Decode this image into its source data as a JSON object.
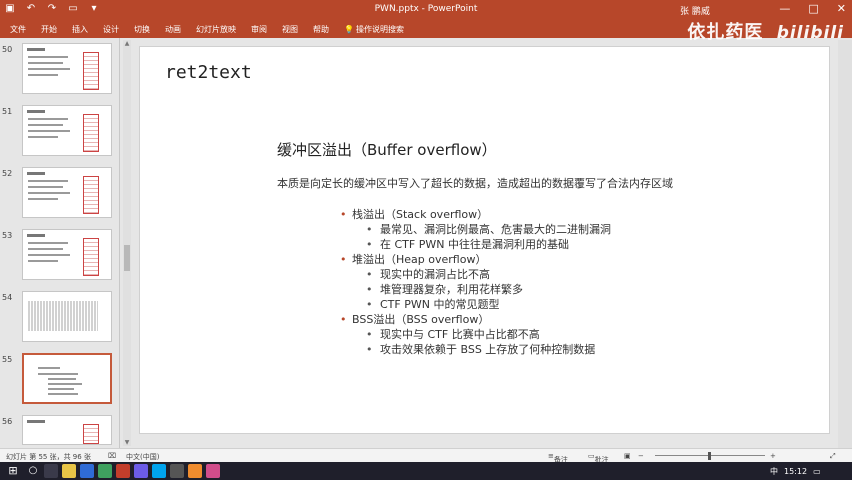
{
  "window": {
    "doc_title": "PWN.pptx - PowerPoint",
    "user": "张 鹏威",
    "controls": [
      "—",
      "□",
      "✕"
    ]
  },
  "ribbon": {
    "tabs": [
      "文件",
      "开始",
      "插入",
      "设计",
      "切换",
      "动画",
      "幻灯片放映",
      "审阅",
      "视图",
      "帮助"
    ],
    "tell_me": "操作说明搜索"
  },
  "watermark": {
    "text1": "依扎药医",
    "text2": "bilibili"
  },
  "thumbnails": {
    "numbers": [
      "50",
      "51",
      "52",
      "53",
      "54",
      "55",
      "56"
    ]
  },
  "slide": {
    "title": "ret2text",
    "heading": "缓冲区溢出（Buffer overflow）",
    "description": "本质是向定长的缓冲区中写入了超长的数据，造成超出的数据覆写了合法内存区域",
    "items": [
      {
        "label": "栈溢出（Stack overflow）",
        "children": [
          "最常见、漏洞比例最高、危害最大的二进制漏洞",
          "在 CTF PWN 中往往是漏洞利用的基础"
        ]
      },
      {
        "label": "堆溢出（Heap overflow）",
        "children": [
          "现实中的漏洞占比不高",
          "堆管理器复杂，利用花样繁多",
          "CTF PWN 中的常见题型"
        ]
      },
      {
        "label": "BSS溢出（BSS overflow）",
        "children": [
          "现实中与 CTF 比赛中占比都不高",
          "攻击效果依赖于 BSS 上存放了何种控制数据"
        ]
      }
    ]
  },
  "status": {
    "slide_count": "幻灯片 第 55 张，共 96 张",
    "language": "中文(中国)",
    "notes": "备注",
    "comments": "批注"
  },
  "taskbar": {
    "ime": "中",
    "time": "15:12"
  },
  "colors": {
    "accent": "#b7472a"
  }
}
